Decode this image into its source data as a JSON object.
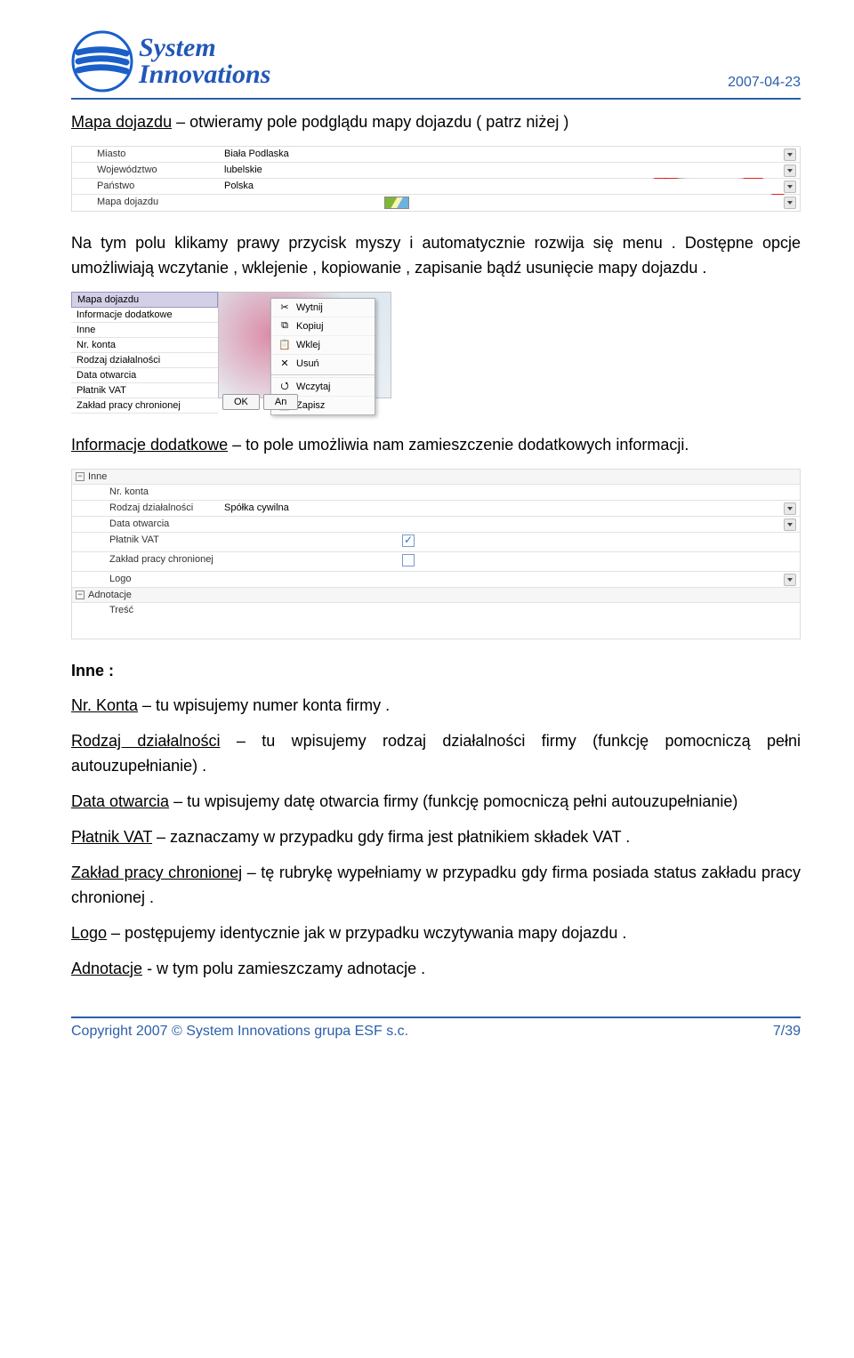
{
  "header": {
    "logo_line1": "System",
    "logo_line2": "Innovations",
    "date": "2007-04-23"
  },
  "text": {
    "p1_u": "Mapa dojazdu",
    "p1_rest": " – otwieramy pole podglądu mapy dojazdu ( patrz niżej )",
    "p2": "Na tym polu klikamy prawy przycisk myszy i automatycznie rozwija się menu . Dostępne opcje umożliwiają wczytanie , wklejenie , kopiowanie , zapisanie bądź usunięcie mapy dojazdu .",
    "p3_u": "Informacje dodatkowe",
    "p3_rest": " – to pole umożliwia nam zamieszczenie dodatkowych informacji.",
    "inne_head": "Inne :",
    "nrkonta_u": "Nr. Konta",
    "nrkonta_rest": " – tu wpisujemy numer konta firmy .",
    "rodzaj_u": "Rodzaj działalności",
    "rodzaj_rest": " – tu wpisujemy rodzaj działalności firmy (funkcję pomocniczą pełni autouzupełnianie) .",
    "data_u": "Data otwarcia",
    "data_rest": " – tu wpisujemy datę otwarcia firmy (funkcję pomocniczą pełni autouzupełnianie)",
    "platnik_u": "Płatnik VAT",
    "platnik_rest": " – zaznaczamy w przypadku gdy firma jest płatnikiem składek VAT .",
    "zaklad_u": "Zakład pracy chronionej",
    "zaklad_rest": " – tę rubrykę wypełniamy w przypadku gdy firma posiada status zakładu pracy chronionej .",
    "logo_u": "Logo",
    "logo_rest": " – postępujemy identycznie jak w przypadku wczytywania mapy dojazdu .",
    "adnot_u": "Adnotacje",
    "adnot_rest": " - w tym polu zamieszczamy adnotacje ."
  },
  "shot1": {
    "rows": [
      {
        "label": "Miasto",
        "value": "Biała Podlaska",
        "dd": true
      },
      {
        "label": "Województwo",
        "value": "lubelskie",
        "dd": true
      },
      {
        "label": "Państwo",
        "value": "Polska",
        "dd": true
      },
      {
        "label": "Mapa dojazdu",
        "value": "",
        "dd": true,
        "thumb": true
      }
    ]
  },
  "shot2": {
    "left_selected": "Mapa dojazdu",
    "left_rows": [
      "Informacje dodatkowe",
      "Inne",
      "Nr. konta",
      "Rodzaj działalności",
      "Data otwarcia",
      "Płatnik VAT",
      "Zakład pracy chronionej"
    ],
    "menu": [
      "Wytnij",
      "Kopiuj",
      "Wklej",
      "Usuń",
      "—",
      "Wczytaj",
      "Zapisz"
    ],
    "btn_ok": "OK",
    "btn_an": "An"
  },
  "shot3": {
    "group1": "Inne",
    "group2": "Adnotacje",
    "rows": [
      {
        "label": "Nr. konta",
        "value": ""
      },
      {
        "label": "Rodzaj działalności",
        "value": "Spółka cywilna",
        "dd": true
      },
      {
        "label": "Data otwarcia",
        "value": "",
        "dd": true
      },
      {
        "label": "Płatnik VAT",
        "value": "",
        "check": true,
        "checked": true
      },
      {
        "label": "Zakład pracy chronionej",
        "value": "",
        "check": true,
        "checked": false
      },
      {
        "label": "Logo",
        "value": "",
        "dd": true
      }
    ],
    "tresc": "Treść"
  },
  "footer": {
    "left": "Copyright 2007 © System Innovations grupa ESF s.c.",
    "right": "7/39"
  }
}
